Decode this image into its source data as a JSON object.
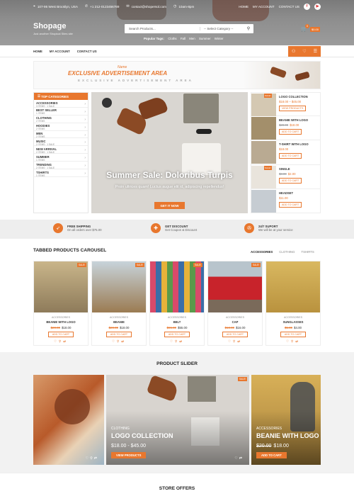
{
  "topbar": {
    "address": "107-95 West Brooklyn, USA",
    "phone": "+1 212-0123456789",
    "email": "contact@shopersol.com",
    "hours": "10am-8pm",
    "links": [
      "HOME",
      "MY ACCOUNT",
      "CONTACT US"
    ]
  },
  "brand": {
    "name": "Shopage",
    "tagline": "Just another Shopical Sites site"
  },
  "search": {
    "placeholder": "Search Products...",
    "category": "-- Select Category --"
  },
  "popular": {
    "label": "Popular Tags:",
    "tags": [
      "Cloths",
      "Fall",
      "Men",
      "Summer",
      "Winter"
    ]
  },
  "cart": {
    "count": "0",
    "total": "$0.00"
  },
  "nav": {
    "items": [
      "HOME",
      "MY ACCOUNT",
      "CONTACT US"
    ]
  },
  "banner": {
    "script": "Name",
    "title": "EXCLUSIVE ADVERTISEMENT AREA",
    "subtitle": "EXCLUSIVE ADVERTISEMENT AREA"
  },
  "categories": {
    "heading": "TOP CATEGORIES",
    "items": [
      {
        "name": "ACCESSORIES",
        "sub": "3 ITEMS · 1 SALE"
      },
      {
        "name": "BEST SELLER",
        "sub": "1 ITEMS"
      },
      {
        "name": "CLOTHING",
        "sub": "2 ITEMS"
      },
      {
        "name": "HOODIES",
        "sub": "2 ITEMS"
      },
      {
        "name": "MEN",
        "sub": "2 ITEMS"
      },
      {
        "name": "MUSIC",
        "sub": "2 ITEMS · 1 SALE"
      },
      {
        "name": "NEW ARRIVAL",
        "sub": "2 ITEMS · 1 SALE"
      },
      {
        "name": "SUMMER",
        "sub": "1 ITEMS"
      },
      {
        "name": "TRENDING",
        "sub": "2 ITEMS · 1 SALE"
      },
      {
        "name": "TSHIRTS",
        "sub": "1 ITEMS"
      }
    ]
  },
  "hero": {
    "title": "Summer Sale: Doloribus Turpis",
    "subtitle": "Proin ultrices quam! Luctus augue elit id, adipiscing repellendus!",
    "cta": "GET IT NOW"
  },
  "side_products": [
    {
      "name": "LOGO COLLECTION",
      "price": "$18.00 – $45.00",
      "old": "",
      "button": "VIEW PRODUCTS",
      "sale": "SALE!"
    },
    {
      "name": "BEANIE WITH LOGO",
      "price": "$18.00",
      "old": "$20.00",
      "button": "ADD TO CART",
      "sale": ""
    },
    {
      "name": "T-SHIRT WITH LOGO",
      "price": "$18.00",
      "old": "",
      "button": "ADD TO CART",
      "sale": ""
    },
    {
      "name": "SINGLE",
      "price": "$2.00",
      "old": "$3.00",
      "button": "ADD TO CART",
      "sale": "SALE!"
    },
    {
      "name": "HEADSET",
      "price": "$11.00",
      "old": "",
      "button": "ADD TO CART",
      "sale": ""
    }
  ],
  "features": [
    {
      "title": "FREE SHIPPING",
      "desc": "On all orders over $75.00",
      "icon": "rocket-icon",
      "glyph": "➶"
    },
    {
      "title": "GET DISCOUNT",
      "desc": "Get Coupon & Discount",
      "icon": "gift-icon",
      "glyph": "✚"
    },
    {
      "title": "24/7 SUPORT",
      "desc": "We will be at your service",
      "icon": "lifebuoy-icon",
      "glyph": "✇"
    }
  ],
  "tabbed": {
    "title": "TABBED PRODUCTS CAROUSEL",
    "tabs": [
      "ACCESSORIES",
      "CLOTHING",
      "TSHIRTS"
    ],
    "products": [
      {
        "cat": "ACCESSORIES",
        "name": "BEANIE WITH LOGO",
        "old": "$20.00",
        "price": "$18.00",
        "sale": "SALE!",
        "button": "ADD TO CART"
      },
      {
        "cat": "ACCESSORIES",
        "name": "BEANIE",
        "old": "$20.00",
        "price": "$18.00",
        "sale": "SALE!",
        "button": "ADD TO CART"
      },
      {
        "cat": "ACCESSORIES",
        "name": "BELT",
        "old": "$65.00",
        "price": "$55.00",
        "sale": "SALE!",
        "button": "ADD TO CART"
      },
      {
        "cat": "ACCESSORIES",
        "name": "CAP",
        "old": "$18.00",
        "price": "$16.00",
        "sale": "SALE!",
        "button": "ADD TO CART"
      },
      {
        "cat": "ACCESSORIES",
        "name": "SUNGLASSES",
        "old": "$5.00",
        "price": "$4.00",
        "sale": "",
        "button": "ADD TO CART"
      }
    ]
  },
  "slider": {
    "title": "PRODUCT SLIDER",
    "center": {
      "cat": "CLOTHING",
      "name": "LOGO COLLECTION",
      "price": "$18.00 - $45.00",
      "button": "VIEW PRODUCTS",
      "sale": "SALE!"
    },
    "right": {
      "cat": "ACCESSORIES",
      "name": "BEANIE WITH LOGO",
      "old": "$20.00",
      "price": "$18.00",
      "button": "ADD TO CART"
    }
  },
  "offers": {
    "title": "STORE OFFERS"
  },
  "colors": {
    "accent": "#e8772e"
  }
}
